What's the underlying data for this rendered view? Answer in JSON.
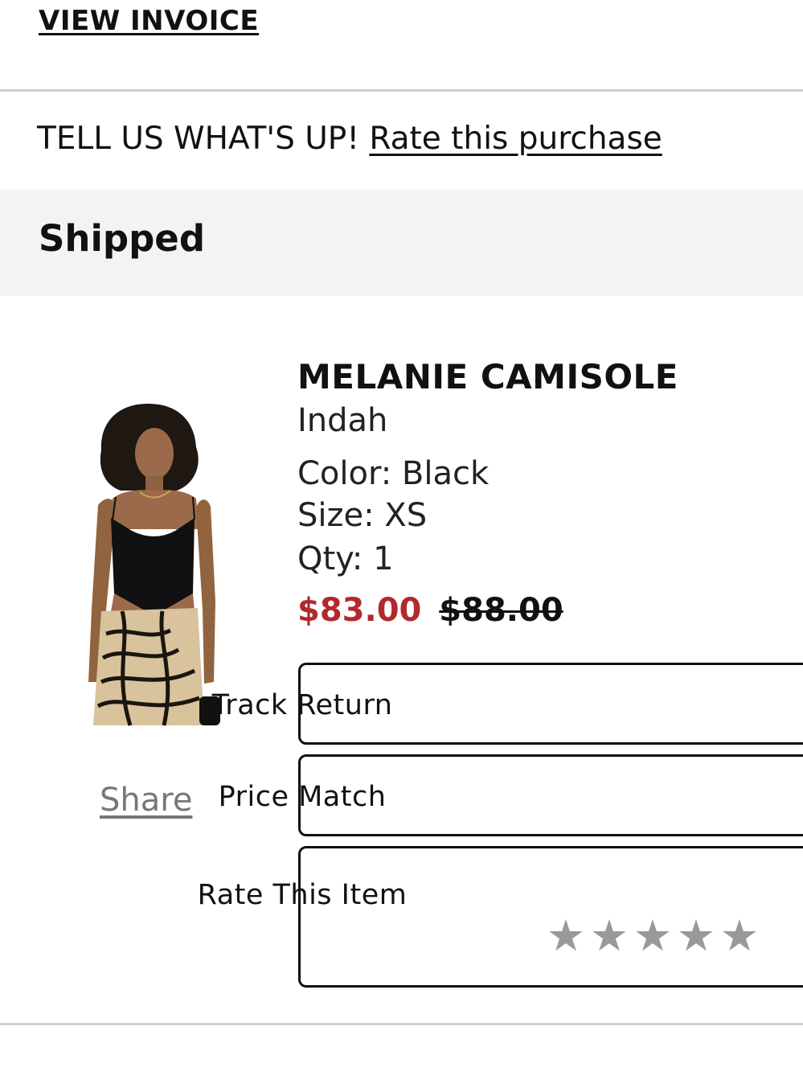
{
  "header": {
    "view_invoice_label": "VIEW INVOICE"
  },
  "feedback": {
    "prompt": "TELL US WHAT'S UP!",
    "rate_link_label": "Rate this purchase"
  },
  "order_status": {
    "label": "Shipped"
  },
  "product": {
    "name": "MELANIE CAMISOLE",
    "brand": "Indah",
    "color_line": "Color: Black",
    "size_line": "Size: XS",
    "qty_line": "Qty: 1",
    "sale_price": "$83.00",
    "original_price": "$88.00",
    "share_label": "Share",
    "image_icon": "product-photo"
  },
  "actions": {
    "track_return_label": "Track Return",
    "price_match_label": "Price Match",
    "rate_item_label": "Rate This Item",
    "rating": {
      "value": 0,
      "max": 5
    }
  },
  "colors": {
    "sale_price": "#b1292d",
    "status_band": "#f3f3f3",
    "star_empty": "#999999",
    "share_link": "#777777"
  }
}
